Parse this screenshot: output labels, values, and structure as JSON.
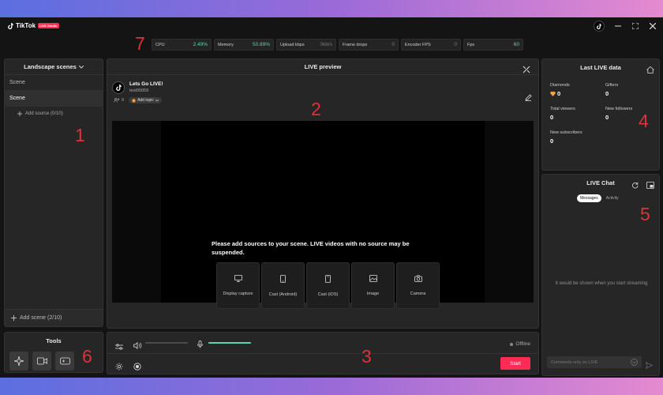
{
  "app": {
    "logo_text": "TikTok",
    "logo_badge": "LIVE Studio"
  },
  "stats": [
    {
      "label": "CPU",
      "value": "2.49%"
    },
    {
      "label": "Memory",
      "value": "50.89%"
    },
    {
      "label": "Upload kbps",
      "value": "0kb/s"
    },
    {
      "label": "Frame drops",
      "value": "0"
    },
    {
      "label": "Encoder FPS",
      "value": "0"
    },
    {
      "label": "Fps",
      "value": "60"
    }
  ],
  "markers": [
    "1",
    "2",
    "3",
    "4",
    "5",
    "6",
    "7"
  ],
  "scenes": {
    "header": "Landscape scenes",
    "items": [
      "Scene",
      "Scene"
    ],
    "add_source": "Add source (0/10)",
    "add_scene": "Add scene (2/10)"
  },
  "tools": {
    "title": "Tools"
  },
  "preview": {
    "title": "LIVE preview",
    "live_title": "Lets Go LIVE!",
    "username": "test00059",
    "viewers": "0",
    "topic": "Add topic",
    "message": "Please add sources to your scene. LIVE videos with no source may be suspended.",
    "sources": [
      "Display capture",
      "Cast (Android)",
      "Cast (iOS)",
      "Image",
      "Camera"
    ]
  },
  "controls": {
    "status": "Offline",
    "start": "Start",
    "speaker_level": 0.0,
    "mic_level": 1.0
  },
  "last_live": {
    "title": "Last LIVE data",
    "metrics": [
      {
        "label": "Diamonds",
        "value": "0"
      },
      {
        "label": "Gifters",
        "value": "0"
      },
      {
        "label": "Total viewers",
        "value": "0"
      },
      {
        "label": "New followers",
        "value": "0"
      },
      {
        "label": "New subscribers",
        "value": "0"
      }
    ]
  },
  "chat": {
    "title": "LIVE Chat",
    "tabs": [
      "Messages",
      "Activity"
    ],
    "empty": "It would be shown when you start streaming",
    "placeholder": "Comments only on LIVE"
  },
  "colors": {
    "accent": "#fe2c55",
    "good": "#5bd6a7",
    "marker": "#e0303a"
  }
}
